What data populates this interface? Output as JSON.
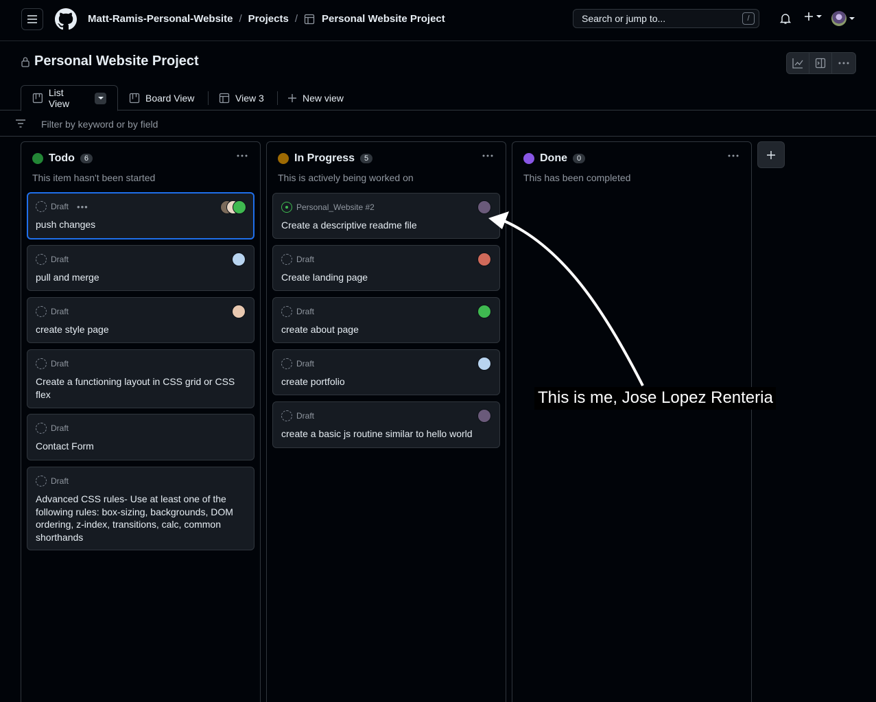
{
  "header": {
    "breadcrumb": [
      "Matt-Ramis-Personal-Website",
      "Projects",
      "Personal Website Project"
    ],
    "search_placeholder": "Search or jump to...",
    "search_shortcut": "/"
  },
  "project": {
    "title": "Personal Website Project"
  },
  "tabs": [
    {
      "label": "List View"
    },
    {
      "label": "Board View"
    },
    {
      "label": "View 3"
    },
    {
      "label": "New view"
    }
  ],
  "filter": {
    "placeholder": "Filter by keyword or by field"
  },
  "columns": [
    {
      "name": "Todo",
      "count": "6",
      "color": "#238636",
      "description": "This item hasn't been started",
      "cards": [
        {
          "meta": "Draft",
          "title": "push changes"
        },
        {
          "meta": "Draft",
          "title": "pull and merge"
        },
        {
          "meta": "Draft",
          "title": "create style page"
        },
        {
          "meta": "Draft",
          "title": "Create a functioning layout in CSS grid or CSS flex"
        },
        {
          "meta": "Draft",
          "title": "Contact Form"
        },
        {
          "meta": "Draft",
          "title": "Advanced CSS rules- Use at least one of the following rules: box-sizing, backgrounds, DOM ordering, z-index, transitions, calc, common shorthands"
        }
      ]
    },
    {
      "name": "In Progress",
      "count": "5",
      "color": "#9e6a03",
      "description": "This is actively being worked on",
      "cards": [
        {
          "meta": "Personal_Website #2",
          "title": "Create a descriptive readme file"
        },
        {
          "meta": "Draft",
          "title": "Create landing page"
        },
        {
          "meta": "Draft",
          "title": "create about page"
        },
        {
          "meta": "Draft",
          "title": "create portfolio"
        },
        {
          "meta": "Draft",
          "title": "create a basic js routine similar to hello world"
        }
      ]
    },
    {
      "name": "Done",
      "count": "0",
      "color": "#8957e5",
      "description": "This has been completed",
      "cards": []
    }
  ],
  "annotation": {
    "text": "This is me, Jose Lopez Renteria"
  },
  "colors": {
    "background": "#010409",
    "card": "#161b22",
    "border": "#30363d",
    "accent": "#1f6feb"
  }
}
